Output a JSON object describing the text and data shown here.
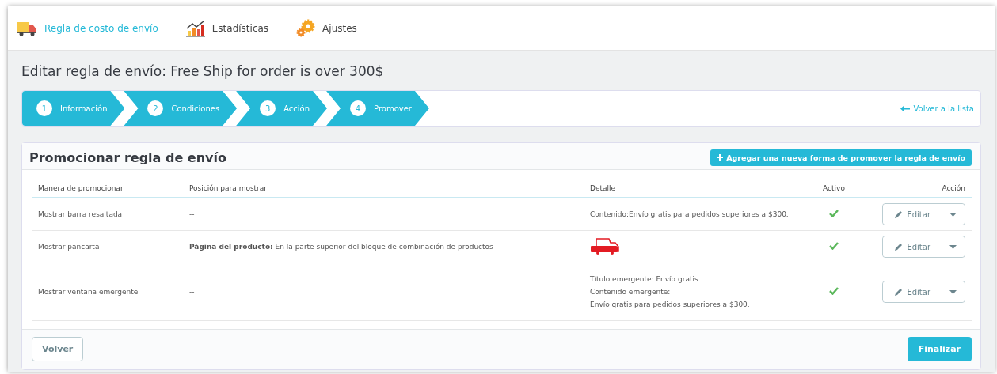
{
  "nav": [
    {
      "label": "Regla de costo de envío",
      "selected": true
    },
    {
      "label": "Estadísticas",
      "selected": false
    },
    {
      "label": "Ajustes",
      "selected": false
    }
  ],
  "page_title": "Editar regla de envío: Free Ship for order is over 300$",
  "steps": [
    {
      "number": "1",
      "label": "Información"
    },
    {
      "number": "2",
      "label": "Condiciones"
    },
    {
      "number": "3",
      "label": "Acción"
    },
    {
      "number": "4",
      "label": "Promover"
    }
  ],
  "back_link": "Volver a la lista",
  "panel": {
    "title": "Promocionar regla de envío",
    "add_button": "Agregar una nueva forma de promover la regla de envío",
    "columns": [
      "Manera de promocionar",
      "Posición para mostrar",
      "Detalle",
      "Activo",
      "Acción"
    ],
    "rows": [
      {
        "method": "Mostrar barra resaltada",
        "position": "--",
        "kind": "text",
        "detail": [
          "Contenido:Envío gratis para pedidos superiores a $300."
        ],
        "active": true,
        "action": "Editar"
      },
      {
        "method": "Mostrar pancarta",
        "position": "**Página del producto:** En la parte superior del bloque de combinación de productos",
        "kind": "banner",
        "active": true,
        "action": "Editar"
      },
      {
        "method": "Mostrar ventana emergente",
        "position": "--",
        "kind": "text",
        "detail": [
          "Título emergente: Envío gratis",
          "Contenido emergente:",
          "Envío gratis para pedidos superiores a $300."
        ],
        "active": true,
        "action": "Editar"
      }
    ],
    "back_button": "Volver",
    "finish_button": "Finalizar"
  }
}
